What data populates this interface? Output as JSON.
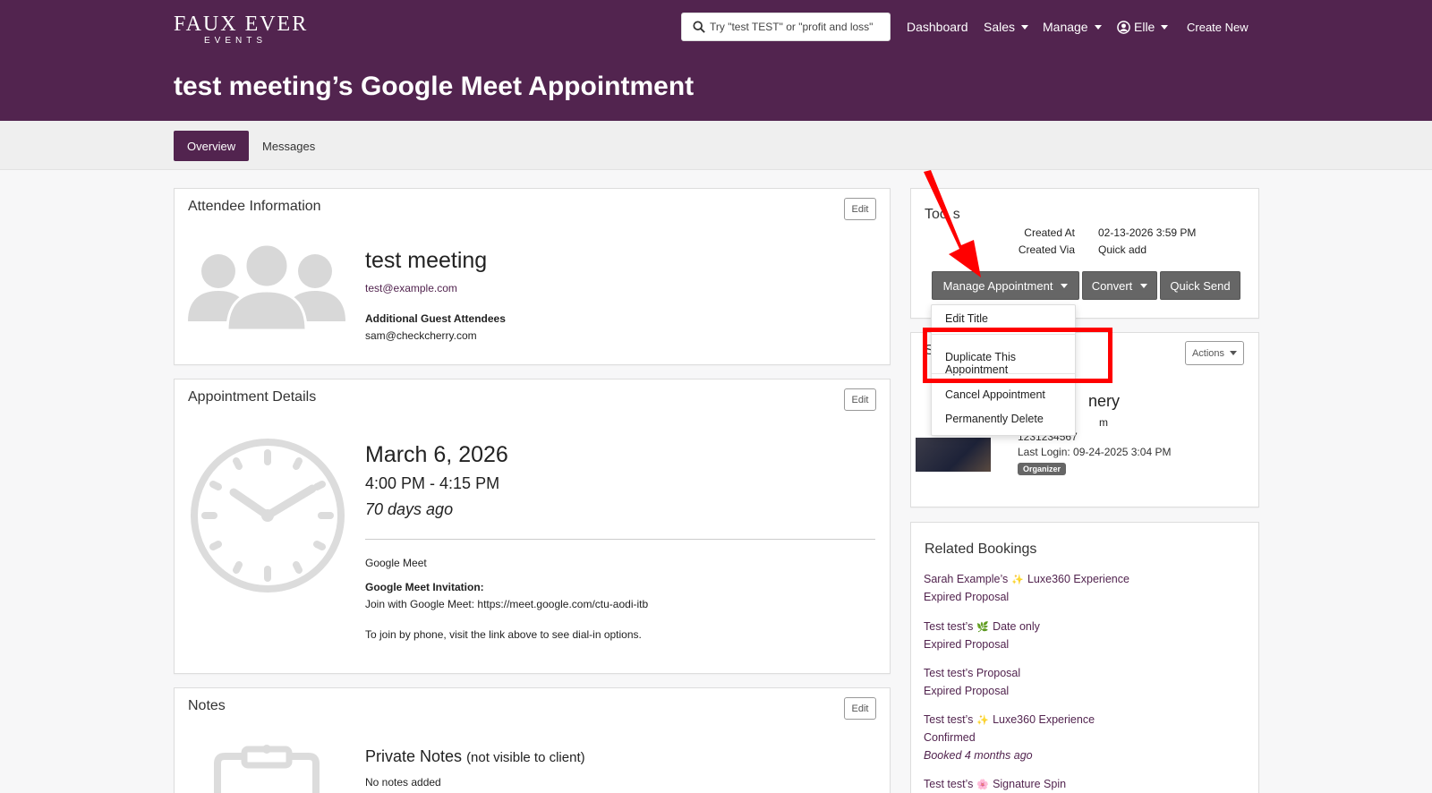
{
  "brand": {
    "line1": "FAUX EVER",
    "line2": "EVENTS"
  },
  "search": {
    "placeholder": "Try \"test TEST\" or \"profit and loss\""
  },
  "nav": {
    "dashboard": "Dashboard",
    "sales": "Sales",
    "manage": "Manage",
    "user": "Elle",
    "create_new": "Create New"
  },
  "page": {
    "title": "test meeting’s Google Meet Appointment"
  },
  "tabs": [
    {
      "label": "Overview"
    },
    {
      "label": "Messages"
    }
  ],
  "attendee": {
    "title": "Attendee Information",
    "edit": "Edit",
    "name": "test meeting",
    "email": "test@example.com",
    "guests_label": "Additional Guest Attendees",
    "guest_email": "sam@checkcherry.com"
  },
  "appointment": {
    "title": "Appointment Details",
    "edit": "Edit",
    "date": "March 6, 2026",
    "time": "4:00 PM - 4:15 PM",
    "relative": "70 days ago",
    "location": "Google Meet",
    "invite_label": "Google Meet Invitation:",
    "invite_text": "Join with Google Meet: https://meet.google.com/ctu-aodi-itb",
    "phone_text": "To join by phone, visit the link above to see dial-in options."
  },
  "notes": {
    "title": "Notes",
    "edit": "Edit",
    "private_label": "Private Notes",
    "private_sub": "(not visible to client)",
    "empty": "No notes added"
  },
  "tools": {
    "title_visible": "Too",
    "title_tail": "s",
    "created_at_label": "Created At",
    "created_at_value": "02-13-2026 3:59 PM",
    "created_via_label": "Created Via",
    "created_via_value": "Quick add",
    "manage_btn": "Manage Appointment",
    "convert_btn": "Convert",
    "quick_send_btn": "Quick Send"
  },
  "manage_menu": {
    "edit_title": "Edit Title",
    "duplicate": "Duplicate This Appointment",
    "cancel": "Cancel Appointment",
    "delete": "Permanently Delete"
  },
  "staff": {
    "letter": "S",
    "actions": "Actions",
    "name_tail": "nery",
    "email_tail": "m",
    "phone": "1231234567",
    "last_login": "Last Login: 09-24-2025 3:04 PM",
    "badge": "Organizer"
  },
  "related": {
    "title": "Related Bookings",
    "items": [
      {
        "pre": "Sarah Example’s",
        "emoji": "✨",
        "post": "Luxe360 Experience",
        "status": "Expired Proposal",
        "note": ""
      },
      {
        "pre": "Test test’s",
        "emoji": "🌿",
        "post": "Date only",
        "status": "Expired Proposal",
        "note": ""
      },
      {
        "pre": "Test test’s Proposal",
        "emoji": "",
        "post": "",
        "status": "Expired Proposal",
        "note": ""
      },
      {
        "pre": "Test test’s",
        "emoji": "✨",
        "post": "Luxe360 Experience",
        "status": "Confirmed",
        "note": "Booked 4 months ago"
      },
      {
        "pre": "Test test’s",
        "emoji": "🌸",
        "post": "Signature Spin",
        "status": "",
        "note": ""
      }
    ]
  },
  "colors": {
    "brand": "#52244f",
    "annotation": "#ff0000",
    "button_dark": "#666666"
  }
}
